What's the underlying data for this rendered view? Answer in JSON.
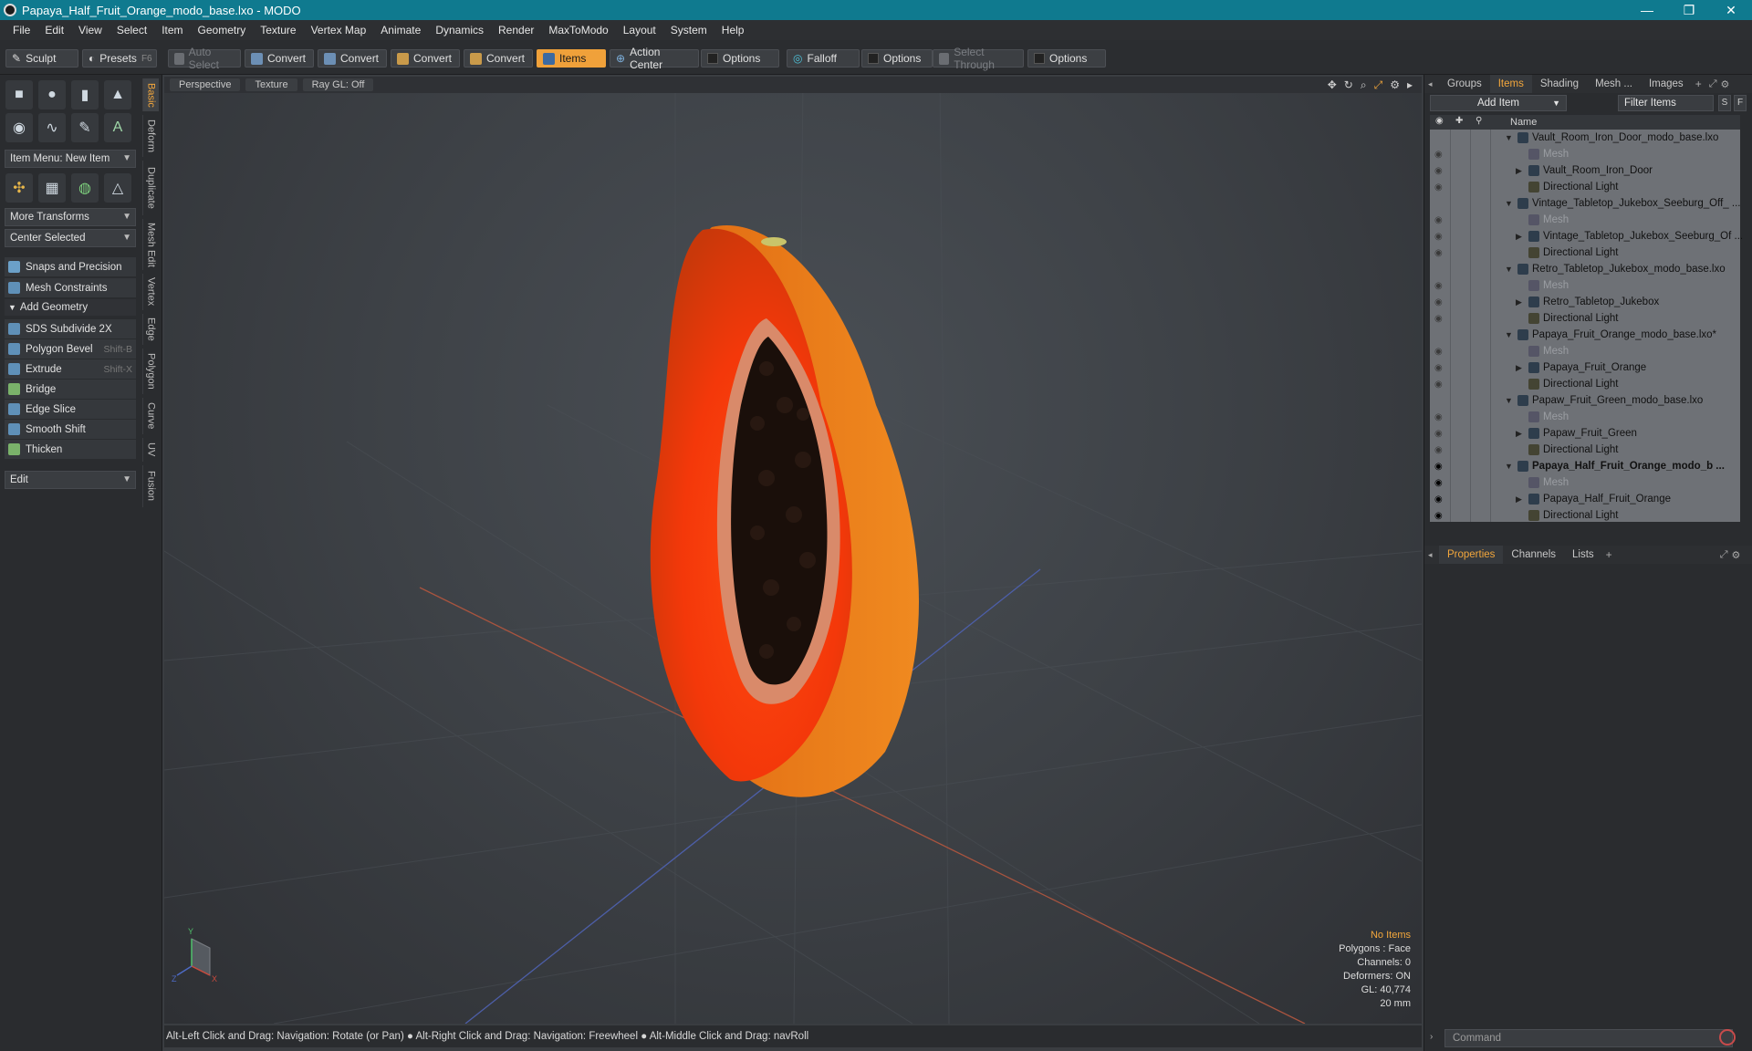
{
  "window": {
    "title": "Papaya_Half_Fruit_Orange_modo_base.lxo - MODO",
    "minimize": "—",
    "maximize": "❐",
    "close": "✕"
  },
  "menu": [
    "File",
    "Edit",
    "View",
    "Select",
    "Item",
    "Geometry",
    "Texture",
    "Vertex Map",
    "Animate",
    "Dynamics",
    "Render",
    "MaxToModo",
    "Layout",
    "System",
    "Help"
  ],
  "toolbar": {
    "sculpt": "Sculpt",
    "presets": "Presets",
    "presets_key": "F6",
    "auto_select": "Auto Select",
    "convert1": "Convert",
    "convert2": "Convert",
    "convert3": "Convert",
    "convert4": "Convert",
    "items": "Items",
    "action_center": "Action Center",
    "options1": "Options",
    "falloff": "Falloff",
    "options2": "Options",
    "select_through": "Select Through",
    "options3": "Options"
  },
  "left": {
    "item_menu": "Item Menu: New Item",
    "more_transforms": "More Transforms",
    "center_selected": "Center Selected",
    "snaps": "Snaps and Precision",
    "mesh_constraints": "Mesh Constraints",
    "add_geometry": "Add Geometry",
    "tools": [
      {
        "label": "SDS Subdivide 2X",
        "shortcut": ""
      },
      {
        "label": "Polygon Bevel",
        "shortcut": "Shift-B"
      },
      {
        "label": "Extrude",
        "shortcut": "Shift-X"
      },
      {
        "label": "Bridge",
        "shortcut": ""
      },
      {
        "label": "Edge Slice",
        "shortcut": ""
      },
      {
        "label": "Smooth Shift",
        "shortcut": ""
      },
      {
        "label": "Thicken",
        "shortcut": ""
      }
    ],
    "edit": "Edit",
    "vtabs": [
      "Basic",
      "Deform",
      "Duplicate",
      "Mesh Edit",
      "Vertex",
      "Edge",
      "Polygon",
      "Curve",
      "UV",
      "Fusion"
    ]
  },
  "viewport": {
    "view": "Perspective",
    "shading": "Texture",
    "raygl": "Ray GL: Off",
    "info": {
      "selection": "No Items",
      "polygons": "Polygons : Face",
      "channels": "Channels: 0",
      "deformers": "Deformers: ON",
      "gl": "GL: 40,774",
      "scale": "20 mm"
    },
    "axis_y": "Y",
    "axis_z": "Z",
    "axis_x": "X"
  },
  "status": "Alt-Left Click and Drag: Navigation: Rotate (or Pan) ● Alt-Right Click and Drag: Navigation: Freewheel ● Alt-Middle Click and Drag: navRoll",
  "right": {
    "tabs": [
      "Groups",
      "Items",
      "Shading",
      "Mesh ...",
      "Images"
    ],
    "add_item": "Add Item",
    "filter": "Filter Items",
    "s": "S",
    "f": "F",
    "name_col": "Name",
    "items": [
      {
        "label": "Vault_Room_Iron_Door_modo_base.lxo",
        "type": "scene"
      },
      {
        "label": "Mesh",
        "type": "mesh"
      },
      {
        "label": "Vault_Room_Iron_Door",
        "type": "group"
      },
      {
        "label": "Directional Light",
        "type": "light"
      },
      {
        "label": "Vintage_Tabletop_Jukebox_Seeburg_Off_ ...",
        "type": "scene"
      },
      {
        "label": "Mesh",
        "type": "mesh"
      },
      {
        "label": "Vintage_Tabletop_Jukebox_Seeburg_Of ...",
        "type": "group"
      },
      {
        "label": "Directional Light",
        "type": "light"
      },
      {
        "label": "Retro_Tabletop_Jukebox_modo_base.lxo",
        "type": "scene"
      },
      {
        "label": "Mesh",
        "type": "mesh"
      },
      {
        "label": "Retro_Tabletop_Jukebox",
        "type": "group"
      },
      {
        "label": "Directional Light",
        "type": "light"
      },
      {
        "label": "Papaya_Fruit_Orange_modo_base.lxo*",
        "type": "scene"
      },
      {
        "label": "Mesh",
        "type": "mesh"
      },
      {
        "label": "Papaya_Fruit_Orange",
        "type": "group"
      },
      {
        "label": "Directional Light",
        "type": "light"
      },
      {
        "label": "Papaw_Fruit_Green_modo_base.lxo",
        "type": "scene"
      },
      {
        "label": "Mesh",
        "type": "mesh"
      },
      {
        "label": "Papaw_Fruit_Green",
        "type": "group"
      },
      {
        "label": "Directional Light",
        "type": "light"
      },
      {
        "label": "Papaya_Half_Fruit_Orange_modo_b ...",
        "type": "scene-active"
      },
      {
        "label": "Mesh",
        "type": "mesh"
      },
      {
        "label": "Papaya_Half_Fruit_Orange",
        "type": "group"
      },
      {
        "label": "Directional Light",
        "type": "light"
      }
    ],
    "prop_tabs": [
      "Properties",
      "Channels",
      "Lists"
    ],
    "command_placeholder": "Command"
  }
}
